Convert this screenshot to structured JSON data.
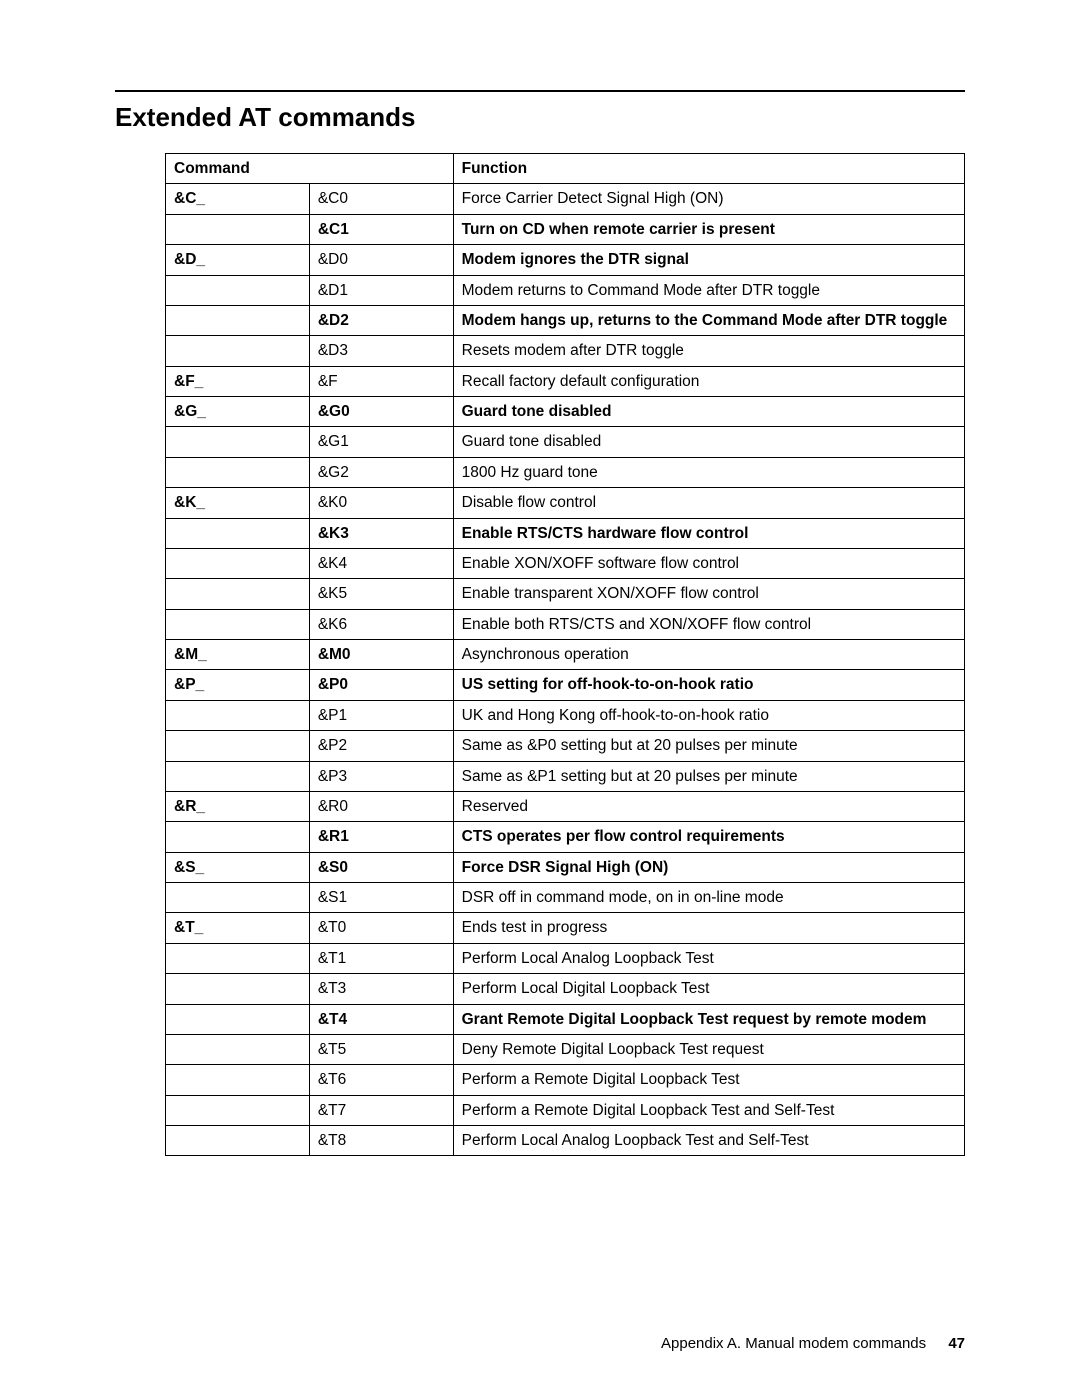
{
  "title": "Extended AT commands",
  "headers": {
    "c1": "Command",
    "c2": "Function"
  },
  "rows": [
    {
      "g": "&C_",
      "gb": true,
      "c": "&C0",
      "cb": false,
      "f": "Force Carrier Detect Signal High (ON)",
      "fb": false
    },
    {
      "g": "",
      "gb": false,
      "c": "&C1",
      "cb": true,
      "f": "Turn on CD when remote carrier is present",
      "fb": true
    },
    {
      "g": "&D_",
      "gb": true,
      "c": "&D0",
      "cb": false,
      "f": "Modem ignores the DTR signal",
      "fb": true
    },
    {
      "g": "",
      "gb": false,
      "c": "&D1",
      "cb": false,
      "f": "Modem returns to Command Mode after DTR toggle",
      "fb": false
    },
    {
      "g": "",
      "gb": false,
      "c": "&D2",
      "cb": true,
      "f": "Modem hangs up, returns to the Command Mode after DTR toggle",
      "fb": true
    },
    {
      "g": "",
      "gb": false,
      "c": "&D3",
      "cb": false,
      "f": "Resets modem after DTR toggle",
      "fb": false
    },
    {
      "g": "&F_",
      "gb": true,
      "c": "&F",
      "cb": false,
      "f": "Recall factory default configuration",
      "fb": false
    },
    {
      "g": "&G_",
      "gb": true,
      "c": "&G0",
      "cb": true,
      "f": "Guard tone disabled",
      "fb": true
    },
    {
      "g": "",
      "gb": false,
      "c": "&G1",
      "cb": false,
      "f": "Guard tone disabled",
      "fb": false
    },
    {
      "g": "",
      "gb": false,
      "c": "&G2",
      "cb": false,
      "f": "1800 Hz guard tone",
      "fb": false
    },
    {
      "g": "&K_",
      "gb": true,
      "c": "&K0",
      "cb": false,
      "f": "Disable flow control",
      "fb": false
    },
    {
      "g": "",
      "gb": false,
      "c": "&K3",
      "cb": true,
      "f": "Enable RTS/CTS hardware flow control",
      "fb": true
    },
    {
      "g": "",
      "gb": false,
      "c": "&K4",
      "cb": false,
      "f": "Enable XON/XOFF software flow control",
      "fb": false
    },
    {
      "g": "",
      "gb": false,
      "c": "&K5",
      "cb": false,
      "f": "Enable transparent XON/XOFF flow control",
      "fb": false
    },
    {
      "g": "",
      "gb": false,
      "c": "&K6",
      "cb": false,
      "f": "Enable both RTS/CTS and XON/XOFF flow control",
      "fb": false
    },
    {
      "g": "&M_",
      "gb": true,
      "c": "&M0",
      "cb": true,
      "f": "Asynchronous operation",
      "fb": false
    },
    {
      "g": "&P_",
      "gb": true,
      "c": "&P0",
      "cb": true,
      "f": "US setting for off-hook-to-on-hook ratio",
      "fb": true
    },
    {
      "g": "",
      "gb": false,
      "c": "&P1",
      "cb": false,
      "f": "UK and Hong Kong off-hook-to-on-hook ratio",
      "fb": false
    },
    {
      "g": "",
      "gb": false,
      "c": "&P2",
      "cb": false,
      "f": "Same as &P0 setting but at 20 pulses per minute",
      "fb": false
    },
    {
      "g": "",
      "gb": false,
      "c": "&P3",
      "cb": false,
      "f": "Same as &P1 setting but at 20 pulses per minute",
      "fb": false
    },
    {
      "g": "&R_",
      "gb": true,
      "c": "&R0",
      "cb": false,
      "f": "Reserved",
      "fb": false
    },
    {
      "g": "",
      "gb": false,
      "c": "&R1",
      "cb": true,
      "f": "CTS operates per flow control requirements",
      "fb": true
    },
    {
      "g": "&S_",
      "gb": true,
      "c": "&S0",
      "cb": true,
      "f": "Force DSR Signal High (ON)",
      "fb": true
    },
    {
      "g": "",
      "gb": false,
      "c": "&S1",
      "cb": false,
      "f": "DSR off in command mode, on in on-line mode",
      "fb": false
    },
    {
      "g": "&T_",
      "gb": true,
      "c": "&T0",
      "cb": false,
      "f": "Ends test in progress",
      "fb": false
    },
    {
      "g": "",
      "gb": false,
      "c": "&T1",
      "cb": false,
      "f": "Perform Local Analog Loopback Test",
      "fb": false
    },
    {
      "g": "",
      "gb": false,
      "c": "&T3",
      "cb": false,
      "f": "Perform Local Digital Loopback Test",
      "fb": false
    },
    {
      "g": "",
      "gb": false,
      "c": "&T4",
      "cb": true,
      "f": "Grant Remote Digital Loopback Test request by remote modem",
      "fb": true
    },
    {
      "g": "",
      "gb": false,
      "c": "&T5",
      "cb": false,
      "f": "Deny Remote Digital Loopback Test request",
      "fb": false
    },
    {
      "g": "",
      "gb": false,
      "c": "&T6",
      "cb": false,
      "f": "Perform a Remote Digital Loopback Test",
      "fb": false
    },
    {
      "g": "",
      "gb": false,
      "c": "&T7",
      "cb": false,
      "f": "Perform a Remote Digital Loopback Test and Self-Test",
      "fb": false
    },
    {
      "g": "",
      "gb": false,
      "c": "&T8",
      "cb": false,
      "f": "Perform Local Analog Loopback Test and Self-Test",
      "fb": false
    }
  ],
  "footer": {
    "appendix": "Appendix A. Manual modem commands",
    "page": "47"
  }
}
